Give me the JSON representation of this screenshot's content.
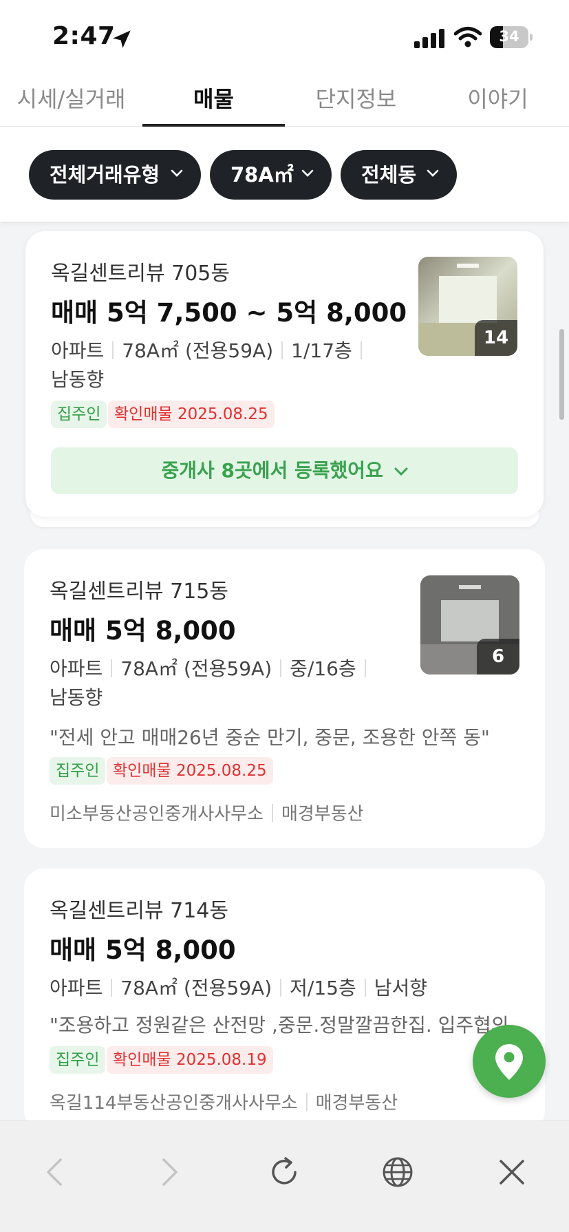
{
  "status_bar": {
    "time": "2:47",
    "battery": "34",
    "battery_level": 0.34
  },
  "tabs": [
    {
      "label": "시세/실거래",
      "active": false
    },
    {
      "label": "매물",
      "active": true
    },
    {
      "label": "단지정보",
      "active": false
    },
    {
      "label": "이야기",
      "active": false
    }
  ],
  "filters": [
    {
      "label": "전체거래유형"
    },
    {
      "label": "78A㎡"
    },
    {
      "label": "전체동"
    }
  ],
  "listings": [
    {
      "title": "옥길센트리뷰 705동",
      "price": "매매 5억 7,500 ~ 5억 8,000",
      "type": "아파트",
      "area": "78A㎡ (전용59A)",
      "floor": "1/17층",
      "direction": "남동향",
      "badge_owner": "집주인",
      "badge_verified": "확인매물 2025.08.25",
      "photo_count": "14",
      "agent_summary": "중개사 8곳에서 등록했어요"
    },
    {
      "title": "옥길센트리뷰 715동",
      "price": "매매 5억 8,000",
      "type": "아파트",
      "area": "78A㎡ (전용59A)",
      "floor": "중/16층",
      "direction": "남동향",
      "description": "\"전세 안고 매매26년 중순 만기, 중문, 조용한 안쪽 동\"",
      "badge_owner": "집주인",
      "badge_verified": "확인매물 2025.08.25",
      "photo_count": "6",
      "agent": "미소부동산공인중개사사무소",
      "source": "매경부동산"
    },
    {
      "title": "옥길센트리뷰 714동",
      "price": "매매 5억 8,000",
      "type": "아파트",
      "area": "78A㎡ (전용59A)",
      "floor": "저/15층",
      "direction": "남서향",
      "description": "\"조용하고 정원같은 산전망 ,중문.정말깔끔한집. 입주협의...\"",
      "badge_owner": "집주인",
      "badge_verified": "확인매물 2025.08.19",
      "agent": "옥길114부동산공인중개사사무소",
      "source": "매경부동산"
    }
  ],
  "colors": {
    "accent_green": "#4caf50",
    "chip_bg": "#1f2328",
    "badge_red": "#e03131",
    "badge_green": "#2f9e44"
  },
  "icons": {
    "map": "map-pin-icon",
    "back": "chevron-left-icon",
    "forward": "chevron-right-icon",
    "reload": "reload-icon",
    "globe": "globe-icon",
    "close": "close-icon"
  }
}
